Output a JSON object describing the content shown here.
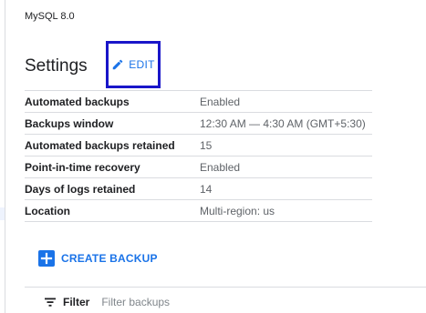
{
  "instance": {
    "version": "MySQL 8.0"
  },
  "settings": {
    "title": "Settings",
    "edit_label": "EDIT",
    "rows": [
      {
        "key": "Automated backups",
        "value": "Enabled"
      },
      {
        "key": "Backups window",
        "value": "12:30 AM — 4:30 AM (GMT+5:30)"
      },
      {
        "key": "Automated backups retained",
        "value": "15"
      },
      {
        "key": "Point-in-time recovery",
        "value": "Enabled"
      },
      {
        "key": "Days of logs retained",
        "value": "14"
      },
      {
        "key": "Location",
        "value": "Multi-region: us"
      }
    ]
  },
  "actions": {
    "create_backup_label": "CREATE BACKUP"
  },
  "filter": {
    "label": "Filter",
    "placeholder": "Filter backups",
    "value": ""
  },
  "icons": {
    "edit": "pencil-icon",
    "create": "plus-icon",
    "filter": "filter-icon"
  },
  "colors": {
    "accent": "#1a73e8",
    "highlight_box": "#1a16c9"
  }
}
